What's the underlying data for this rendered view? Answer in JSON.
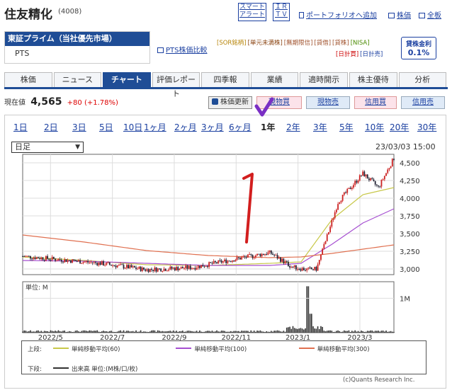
{
  "company": {
    "name": "住友精化",
    "code": "(4008)"
  },
  "header_buttons": {
    "smart_alert": [
      "スマート",
      "アラート"
    ],
    "ir_tv": [
      "ＩＲ",
      "ＴＶ"
    ],
    "portfolio": "ポートフォリオへ追加",
    "stock_price": "株価",
    "full_board": "全板"
  },
  "market": {
    "selected": "東証プライム（当社優先市場）",
    "pts": "PTS",
    "pts_compare": "PTS株価比較"
  },
  "badges": {
    "row1": [
      {
        "label": "[SOR銘柄]",
        "color": "#b8860b"
      },
      {
        "label": "[単元未満株]",
        "color": "#8b4513"
      },
      {
        "label": "[無期限信]",
        "color": "#a0522d"
      },
      {
        "label": "[貸借]",
        "color": "#a0522d"
      },
      {
        "label": "[貸株]",
        "color": "#a0522d"
      },
      {
        "label": "[NISA]",
        "color": "#4a8a00"
      }
    ],
    "row2": [
      {
        "label": "[日計買]",
        "color": "#c00"
      },
      {
        "label": "[日計売]",
        "color": "#1a3fa0"
      }
    ]
  },
  "lending_rate": {
    "label": "貸株金利",
    "value": "0.1%"
  },
  "tabs": [
    "株価",
    "ニュース",
    "チャート",
    "評価レポート",
    "四季報",
    "業績",
    "適時開示",
    "株主優待",
    "分析"
  ],
  "active_tab": "チャート",
  "price": {
    "label": "現在値",
    "value": "4,565",
    "change": "+80 (+1.78%)"
  },
  "actions": {
    "refresh": "株価更新",
    "buy": "現物買",
    "sell": "現物売",
    "margin_buy": "信用買",
    "margin_sell": "信用売"
  },
  "periods": [
    "1日",
    "2日",
    "3日",
    "5日",
    "10日",
    "1ヶ月",
    "2ヶ月",
    "3ヶ月",
    "6ヶ月",
    "1年",
    "2年",
    "3年",
    "5年",
    "10年",
    "20年",
    "30年"
  ],
  "active_period": "1年",
  "chart_controls": {
    "interval": "日足",
    "timestamp": "23/03/03 15:00"
  },
  "chart_data": {
    "type": "line",
    "x_ticks": [
      "2022/5",
      "2022/7",
      "2022/9",
      "2022/11",
      "2023/1",
      "2023/3"
    ],
    "y_ticks": [
      "4,500",
      "4,250",
      "4,000",
      "3,750",
      "3,500",
      "3,250",
      "3,000"
    ],
    "ylim": [
      2920,
      4620
    ],
    "months": [
      0,
      2.5,
      4,
      5.5,
      7,
      8,
      8.7,
      9.2,
      9.5,
      10.2,
      11,
      11.5,
      12
    ],
    "price": [
      3180,
      3080,
      2990,
      3020,
      3150,
      3230,
      3030,
      2990,
      3000,
      3950,
      4350,
      4150,
      4565
    ],
    "series": [
      {
        "name": "単純移動平均(60)",
        "color": "#c8c84a",
        "months": [
          0,
          2,
          4,
          6,
          8,
          9,
          10,
          11,
          12
        ],
        "values": [
          3170,
          3120,
          3060,
          3050,
          3080,
          3100,
          3700,
          4050,
          4150
        ]
      },
      {
        "name": "単純移動平均(100)",
        "color": "#a64fd1",
        "months": [
          0,
          2,
          4,
          6,
          8,
          9,
          10,
          11,
          12
        ],
        "values": [
          3120,
          3110,
          3080,
          3050,
          3050,
          3080,
          3350,
          3650,
          3850
        ]
      },
      {
        "name": "単純移動平均(300)",
        "color": "#e07050",
        "months": [
          0,
          2,
          4,
          6,
          8,
          9,
          10,
          11,
          12
        ],
        "values": [
          3480,
          3380,
          3260,
          3190,
          3160,
          3170,
          3220,
          3280,
          3340
        ]
      }
    ],
    "volume": {
      "unit": "単位: M",
      "tick": "1M"
    }
  },
  "legend": {
    "upper_label": "上段:",
    "lower_label": "下段:",
    "lower_item": "出来高 単位:(M株/口/枚)"
  },
  "copyright": "(c)Quants Research Inc.",
  "annotation": {
    "color": "#7a2fc4"
  }
}
